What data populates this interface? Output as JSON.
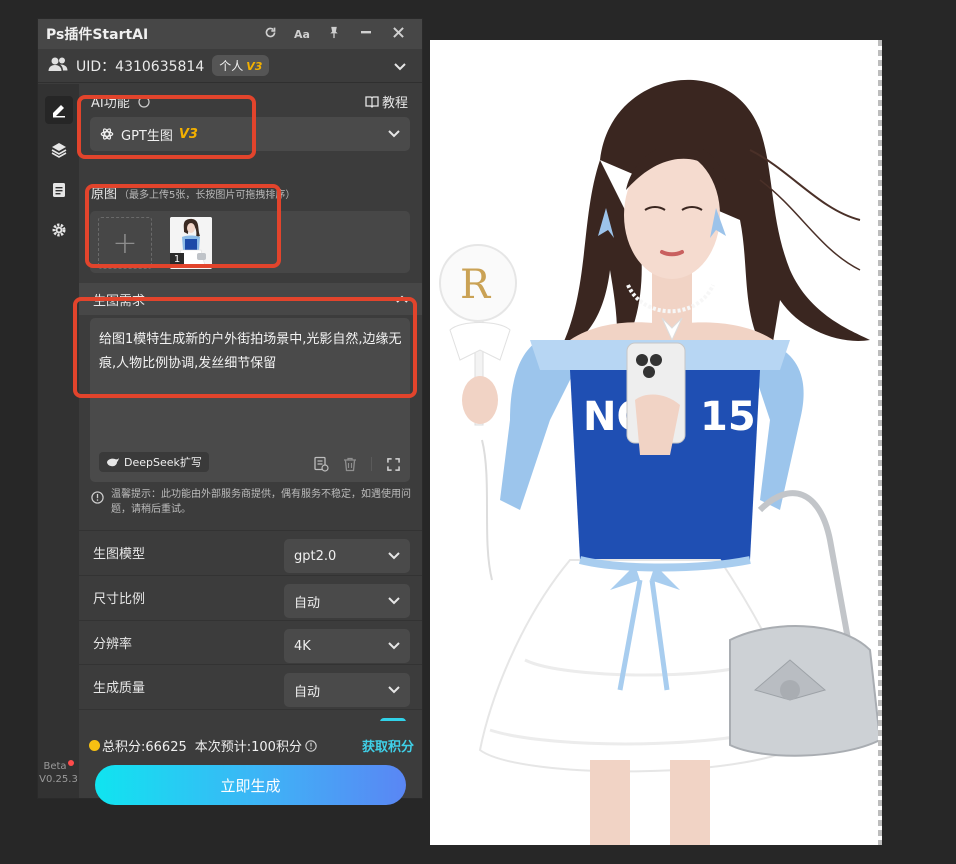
{
  "titlebar": {
    "title": "Ps插件StartAI",
    "icons": [
      "refresh-icon",
      "font-icon",
      "pin-icon",
      "minimize-icon",
      "close-icon"
    ],
    "font_icon_text": "Aa"
  },
  "user": {
    "uid": "UID：4310635814",
    "plan": "个人",
    "plan_version": "V3"
  },
  "ai_function": {
    "label": "AI功能",
    "tutorial": "教程",
    "selected": "GPT生图",
    "version": "V3"
  },
  "source_image": {
    "label": "原图",
    "hint": "（最多上传5张，长按图片可拖拽排序）",
    "add_symbol": "+",
    "thumbnails": [
      {
        "index": "1"
      }
    ]
  },
  "prompt": {
    "header": "生图需求",
    "text": "给图1模特生成新的户外街拍场景中,光影自然,边缘无痕,人物比例协调,发丝细节保留",
    "deepseek_label": "DeepSeek扩写"
  },
  "tip": "温馨提示：此功能由外部服务商提供，偶有服务不稳定，如遇使用问题，请稍后重试。",
  "settings": [
    {
      "label": "生图模型",
      "value": "gpt2.0"
    },
    {
      "label": "尺寸比例",
      "value": "自动"
    },
    {
      "label": "分辨率",
      "value": "4K"
    },
    {
      "label": "生成质量",
      "value": "自动"
    }
  ],
  "footer": {
    "points": "总积分:66625",
    "estimate": "本次预计:100积分",
    "get_points": "获取积分",
    "generate": "立即生成"
  },
  "sidebar": {
    "items": [
      "edit-icon",
      "layers-icon",
      "notes-icon",
      "settings-icon"
    ],
    "beta": "Beta",
    "version": "V0.25.3"
  },
  "colors": {
    "accent": "#3fd0e8",
    "highlight_box": "#e2442c",
    "version_badge": "#f3b000",
    "panel_bg": "#3c3c3c"
  }
}
